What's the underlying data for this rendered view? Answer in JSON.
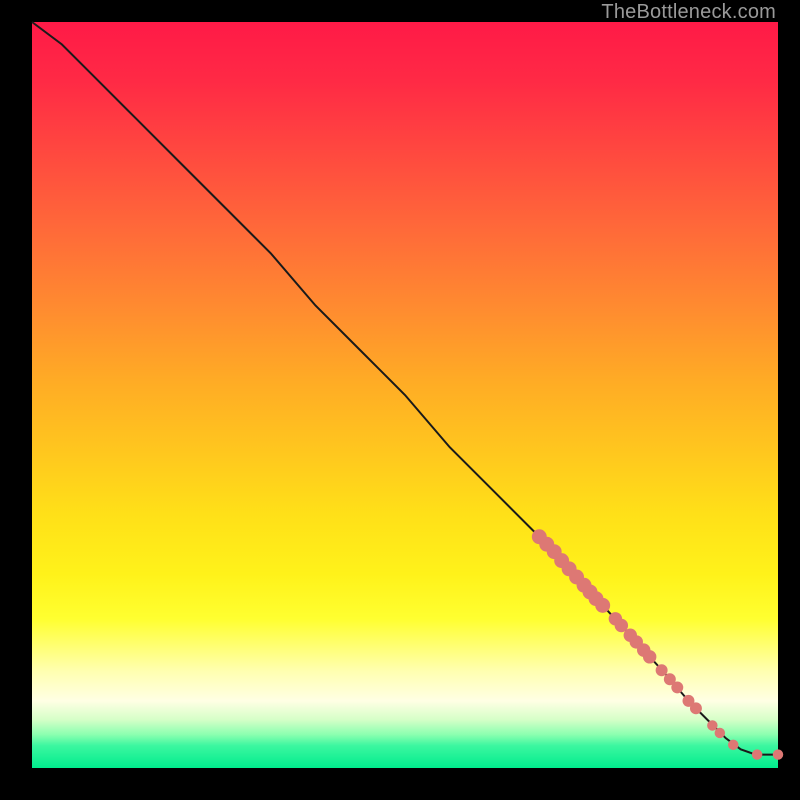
{
  "attribution": "TheBottleneck.com",
  "colors": {
    "dot": "#dd7874",
    "curve": "#1a1a1a",
    "page_bg": "#000000"
  },
  "chart_data": {
    "type": "line",
    "title": "",
    "xlabel": "",
    "ylabel": "",
    "xlim": [
      0,
      100
    ],
    "ylim": [
      0,
      100
    ],
    "grid": false,
    "legend": false,
    "series": [
      {
        "name": "curve",
        "x": [
          0,
          4,
          8,
          14,
          20,
          26,
          32,
          38,
          44,
          50,
          56,
          62,
          68,
          74,
          80,
          85,
          88,
          91,
          93,
          95,
          97,
          100
        ],
        "y": [
          100,
          97,
          93,
          87,
          81,
          75,
          69,
          62,
          56,
          50,
          43,
          37,
          31,
          24.5,
          18,
          12.5,
          9,
          6,
          4,
          2.5,
          1.8,
          1.8
        ]
      }
    ],
    "markers": [
      {
        "x": 68.0,
        "y": 31.0,
        "r": 1.0
      },
      {
        "x": 69.0,
        "y": 30.0,
        "r": 1.0
      },
      {
        "x": 70.0,
        "y": 29.0,
        "r": 1.0
      },
      {
        "x": 71.0,
        "y": 27.8,
        "r": 1.0
      },
      {
        "x": 72.0,
        "y": 26.7,
        "r": 1.0
      },
      {
        "x": 73.0,
        "y": 25.6,
        "r": 1.0
      },
      {
        "x": 74.0,
        "y": 24.5,
        "r": 1.0
      },
      {
        "x": 74.8,
        "y": 23.6,
        "r": 1.0
      },
      {
        "x": 75.6,
        "y": 22.7,
        "r": 1.0
      },
      {
        "x": 76.5,
        "y": 21.8,
        "r": 1.0
      },
      {
        "x": 78.2,
        "y": 20.0,
        "r": 0.9
      },
      {
        "x": 79.0,
        "y": 19.1,
        "r": 0.9
      },
      {
        "x": 80.2,
        "y": 17.8,
        "r": 0.9
      },
      {
        "x": 81.0,
        "y": 16.9,
        "r": 0.9
      },
      {
        "x": 82.0,
        "y": 15.8,
        "r": 0.9
      },
      {
        "x": 82.8,
        "y": 14.9,
        "r": 0.9
      },
      {
        "x": 84.4,
        "y": 13.1,
        "r": 0.8
      },
      {
        "x": 85.5,
        "y": 11.9,
        "r": 0.8
      },
      {
        "x": 86.5,
        "y": 10.8,
        "r": 0.8
      },
      {
        "x": 88.0,
        "y": 9.0,
        "r": 0.8
      },
      {
        "x": 89.0,
        "y": 8.0,
        "r": 0.8
      },
      {
        "x": 91.2,
        "y": 5.7,
        "r": 0.7
      },
      {
        "x": 92.2,
        "y": 4.7,
        "r": 0.7
      },
      {
        "x": 94.0,
        "y": 3.1,
        "r": 0.7
      },
      {
        "x": 97.2,
        "y": 1.8,
        "r": 0.7
      },
      {
        "x": 100.0,
        "y": 1.8,
        "r": 0.7
      }
    ]
  }
}
